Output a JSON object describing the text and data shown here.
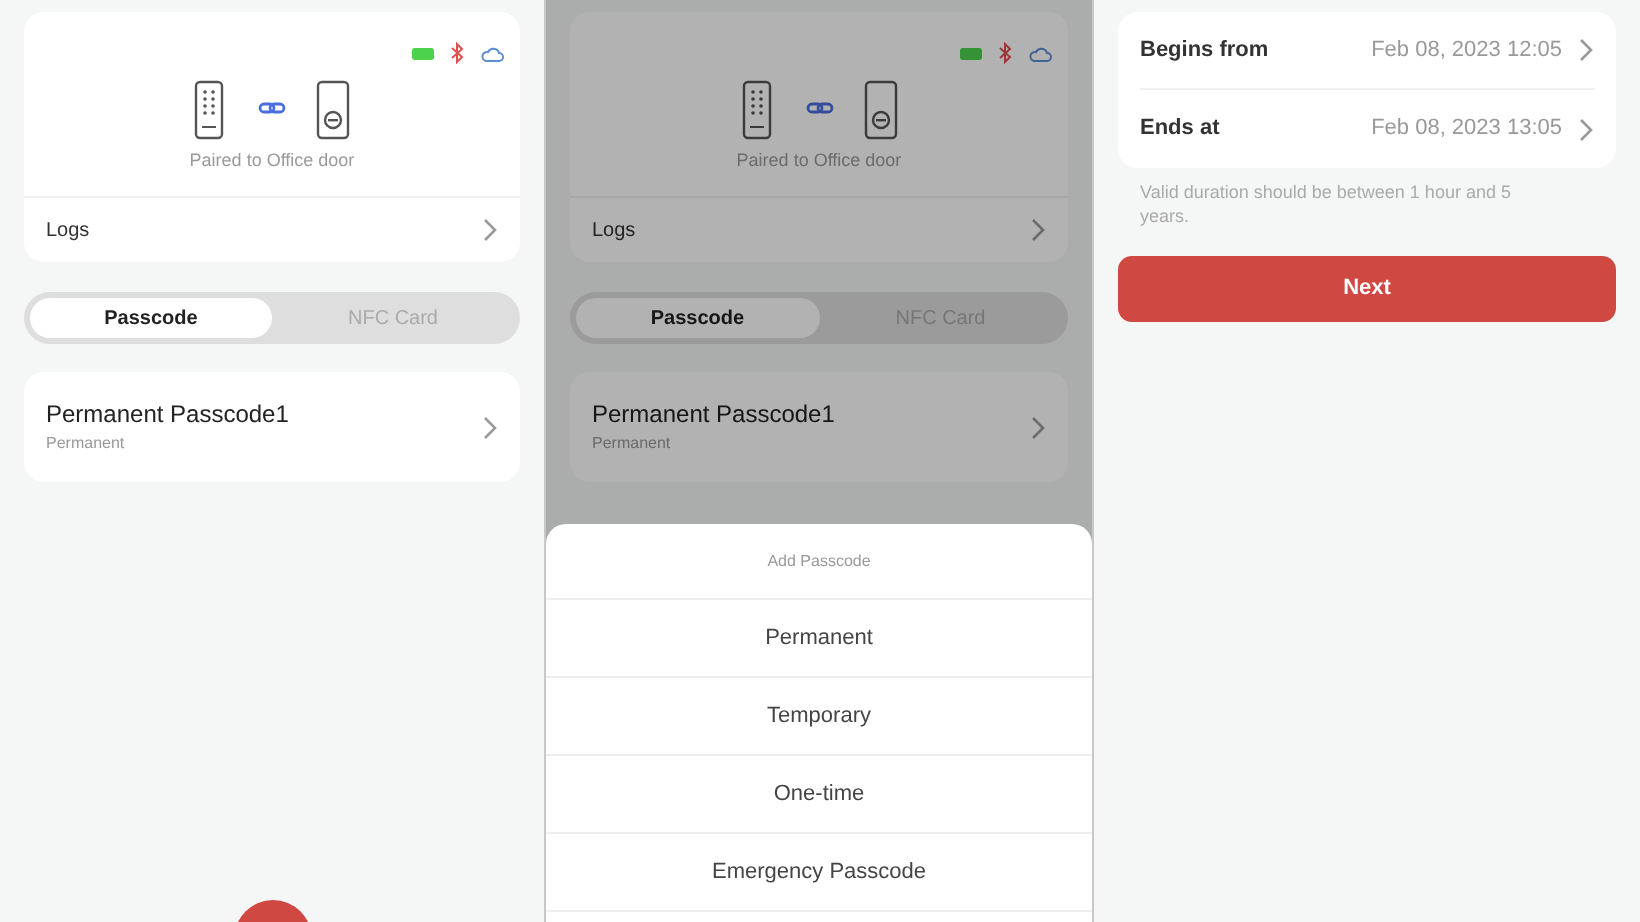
{
  "screens": [
    {
      "kind": "device",
      "dimmed": false,
      "add_button": true,
      "paired_label": "Paired to Office door",
      "logs_label": "Logs",
      "tabs": [
        {
          "label": "Passcode",
          "selected": true
        },
        {
          "label": "NFC Card",
          "selected": false
        }
      ],
      "passcodes": [
        {
          "name": "Permanent Passcode1",
          "type": "Permanent"
        }
      ]
    },
    {
      "kind": "device",
      "dimmed": true,
      "add_button": false,
      "paired_label": "Paired to Office door",
      "logs_label": "Logs",
      "tabs": [
        {
          "label": "Passcode",
          "selected": true
        },
        {
          "label": "NFC Card",
          "selected": false
        }
      ],
      "passcodes": [
        {
          "name": "Permanent Passcode1",
          "type": "Permanent"
        }
      ],
      "sheet": {
        "title": "Add Passcode",
        "options": [
          "Permanent",
          "Temporary",
          "One-time",
          "Emergency Passcode"
        ]
      }
    },
    {
      "kind": "duration",
      "rows": [
        {
          "label": "Begins from",
          "value": "Feb 08, 2023 12:05"
        },
        {
          "label": "Ends at",
          "value": "Feb 08, 2023 13:05"
        }
      ],
      "hint": "Valid duration should be between 1 hour and 5 years.",
      "next_button": "Next"
    }
  ]
}
